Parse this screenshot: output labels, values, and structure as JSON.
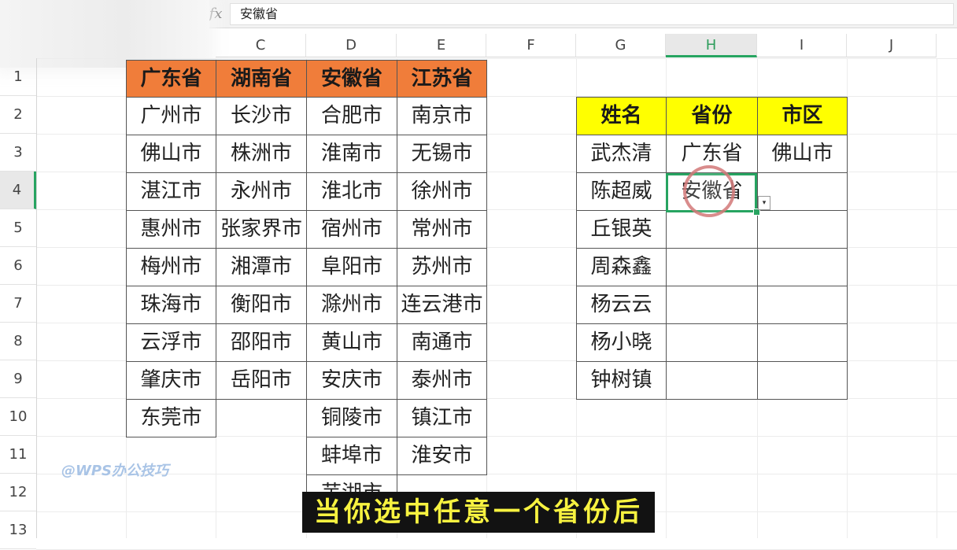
{
  "formula_bar": {
    "fx_label": "fx",
    "value": "安徽省"
  },
  "columns": [
    "C",
    "D",
    "E",
    "F",
    "G",
    "H",
    "I",
    "J"
  ],
  "rows": [
    "1",
    "2",
    "3",
    "4",
    "5",
    "6",
    "7",
    "8",
    "9",
    "10",
    "11",
    "12",
    "13"
  ],
  "province_table": {
    "headers": [
      "广东省",
      "湖南省",
      "安徽省",
      "江苏省"
    ],
    "columns": [
      [
        "广州市",
        "佛山市",
        "湛江市",
        "惠州市",
        "梅州市",
        "珠海市",
        "云浮市",
        "肇庆市",
        "东莞市",
        "",
        ""
      ],
      [
        "长沙市",
        "株洲市",
        "永州市",
        "张家界市",
        "湘潭市",
        "衡阳市",
        "邵阳市",
        "岳阳市",
        "",
        "",
        ""
      ],
      [
        "合肥市",
        "淮南市",
        "淮北市",
        "宿州市",
        "阜阳市",
        "滁州市",
        "黄山市",
        "安庆市",
        "铜陵市",
        "蚌埠市",
        "芜湖市"
      ],
      [
        "南京市",
        "无锡市",
        "徐州市",
        "常州市",
        "苏州市",
        "连云港市",
        "南通市",
        "泰州市",
        "镇江市",
        "淮安市",
        ""
      ]
    ]
  },
  "lookup_table": {
    "headers": [
      "姓名",
      "省份",
      "市区"
    ],
    "rows": [
      [
        "武杰清",
        "广东省",
        "佛山市"
      ],
      [
        "陈超威",
        "安徽省",
        ""
      ],
      [
        "丘银英",
        "",
        ""
      ],
      [
        "周森鑫",
        "",
        ""
      ],
      [
        "杨云云",
        "",
        ""
      ],
      [
        "杨小晓",
        "",
        ""
      ],
      [
        "钟树镇",
        "",
        ""
      ]
    ]
  },
  "dropdown_icon": "▾",
  "watermark": "@WPS办公技巧",
  "subtitle": "当你选中任意一个省份后",
  "colors": {
    "header_orange": "#f07d3a",
    "header_yellow": "#ffff00",
    "selection_green": "#27a461",
    "subtitle_text": "#f7f240"
  }
}
